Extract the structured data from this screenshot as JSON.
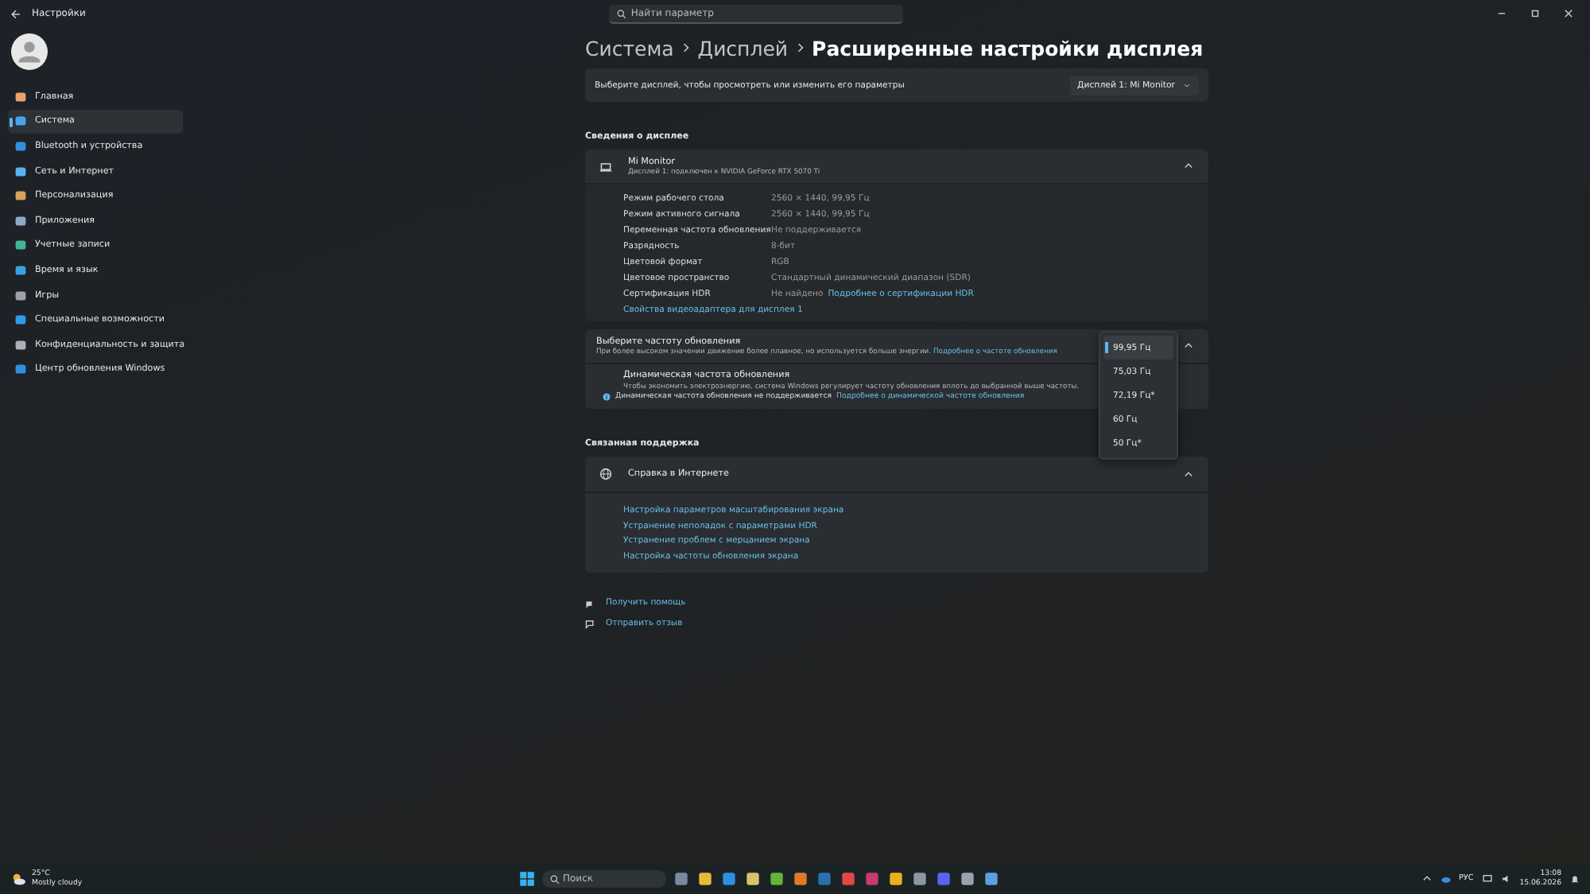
{
  "window": {
    "title": "Настройки"
  },
  "search": {
    "placeholder": "Найти параметр"
  },
  "sidebar": {
    "items": [
      {
        "label": "Главная",
        "selected": false
      },
      {
        "label": "Система",
        "selected": true
      },
      {
        "label": "Bluetooth и устройства",
        "selected": false
      },
      {
        "label": "Сеть и Интернет",
        "selected": false
      },
      {
        "label": "Персонализация",
        "selected": false
      },
      {
        "label": "Приложения",
        "selected": false
      },
      {
        "label": "Учетные записи",
        "selected": false
      },
      {
        "label": "Время и язык",
        "selected": false
      },
      {
        "label": "Игры",
        "selected": false
      },
      {
        "label": "Специальные возможности",
        "selected": false
      },
      {
        "label": "Конфиденциальность и защита",
        "selected": false
      },
      {
        "label": "Центр обновления Windows",
        "selected": false
      }
    ]
  },
  "breadcrumb": [
    "Система",
    "Дисплей",
    "Расширенные настройки дисплея"
  ],
  "display_select": {
    "label": "Выберите дисплей, чтобы просмотреть или изменить его параметры",
    "value": "Дисплей 1: Mi Monitor"
  },
  "display_info": {
    "heading": "Сведения о дисплее",
    "name": "Mi Monitor",
    "subtitle": "Дисплей 1: подключен к NVIDIA GeForce RTX 5070 Ti",
    "expanded": true,
    "rows": [
      {
        "label": "Режим рабочего стола",
        "value": "2560 × 1440, 99,95 Гц"
      },
      {
        "label": "Режим активного сигнала",
        "value": "2560 × 1440, 99,95 Гц"
      },
      {
        "label": "Переменная частота обновления",
        "value": "Не поддерживается"
      },
      {
        "label": "Разрядность",
        "value": "8-бит"
      },
      {
        "label": "Цветовой формат",
        "value": "RGB"
      },
      {
        "label": "Цветовое пространство",
        "value": "Стандартный динамический диапазон (SDR)"
      },
      {
        "label": "Сертификация HDR",
        "value": "Не найдено",
        "link": "Подробнее о сертификации HDR"
      }
    ],
    "link": "Свойства видеоадаптера для дисплея 1"
  },
  "refresh_rate": {
    "title": "Выберите частоту обновления",
    "description": "При более высоком значении движение более плавное, но используется больше энергии.",
    "link": "Подробнее о частоте обновления",
    "expanded": true,
    "options": [
      {
        "label": "99,95 Гц",
        "selected": true
      },
      {
        "label": "75,03 Гц",
        "selected": false
      },
      {
        "label": "72,19 Гц*",
        "selected": false
      },
      {
        "label": "60 Гц",
        "selected": false
      },
      {
        "label": "50 Гц*",
        "selected": false
      }
    ],
    "dynamic": {
      "title": "Динамическая частота обновления",
      "description": "Чтобы экономить электроэнергию, система Windows регулирует частоту обновления вплоть до выбранной выше частоты.",
      "status": "Динамическая частота обновления не поддерживается",
      "link": "Подробнее о динамической частоте обновления"
    }
  },
  "related": {
    "heading": "Связанная поддержка",
    "title": "Справка в Интернете",
    "expanded": true,
    "links": [
      "Настройка параметров масштабирования экрана",
      "Устранение неполадок с параметрами HDR",
      "Устранение проблем с мерцанием экрана",
      "Настройка частоты обновления экрана"
    ]
  },
  "footer_links": [
    "Получить помощь",
    "Отправить отзыв"
  ],
  "taskbar": {
    "weather": {
      "temperature": "25°C",
      "condition": "Mostly cloudy"
    },
    "search_placeholder": "Поиск",
    "language": "РУС",
    "time": "13:08",
    "date": "15.06.2026"
  }
}
